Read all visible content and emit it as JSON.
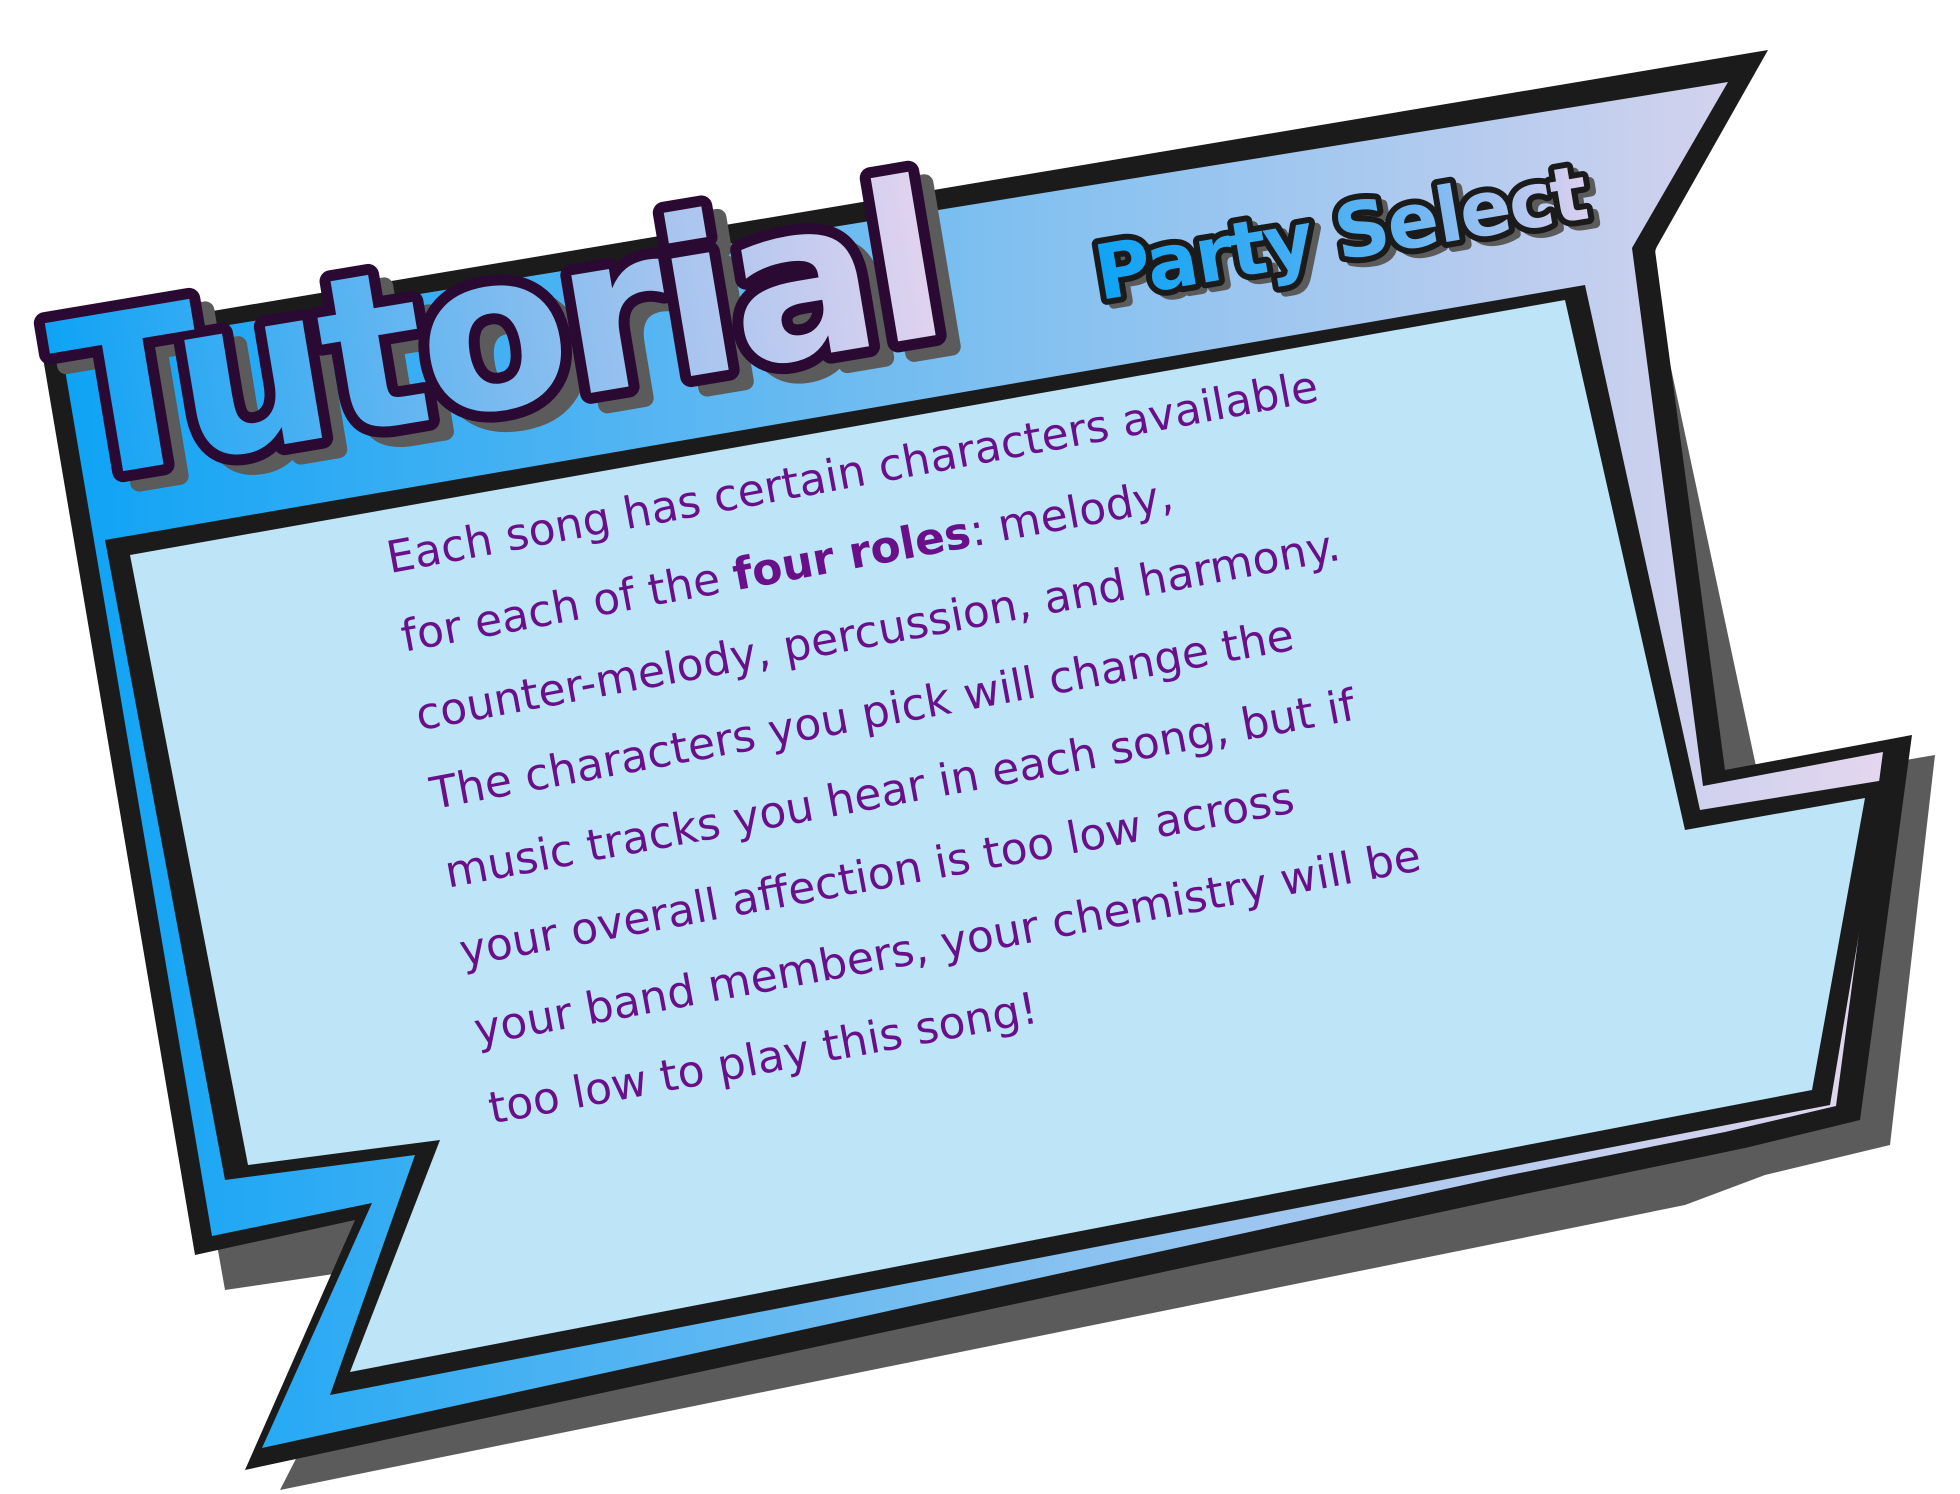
{
  "dialog": {
    "title": "Tutorial",
    "subtitle": "Party Select",
    "lines": [
      [
        "Each song has certain characters available"
      ],
      [
        "for each of the ",
        "four roles",
        ": melody,"
      ],
      [
        "counter-melody, percussion, and harmony."
      ],
      [
        "The characters you pick will change the"
      ],
      [
        "music tracks you hear in each song, but if"
      ],
      [
        "your overall affection is too low across"
      ],
      [
        "your band members, your chemistry will be"
      ],
      [
        "too low to play this song!"
      ]
    ]
  },
  "colors": {
    "text": "#6a0f8a",
    "panel_fill": "#bde4f7",
    "gradient_start": "#0ea3f5",
    "gradient_end": "#e4d6ee",
    "outline": "#1b1b1b",
    "shadow": "#5b5b5b",
    "title_outline": "#2a0a33"
  }
}
